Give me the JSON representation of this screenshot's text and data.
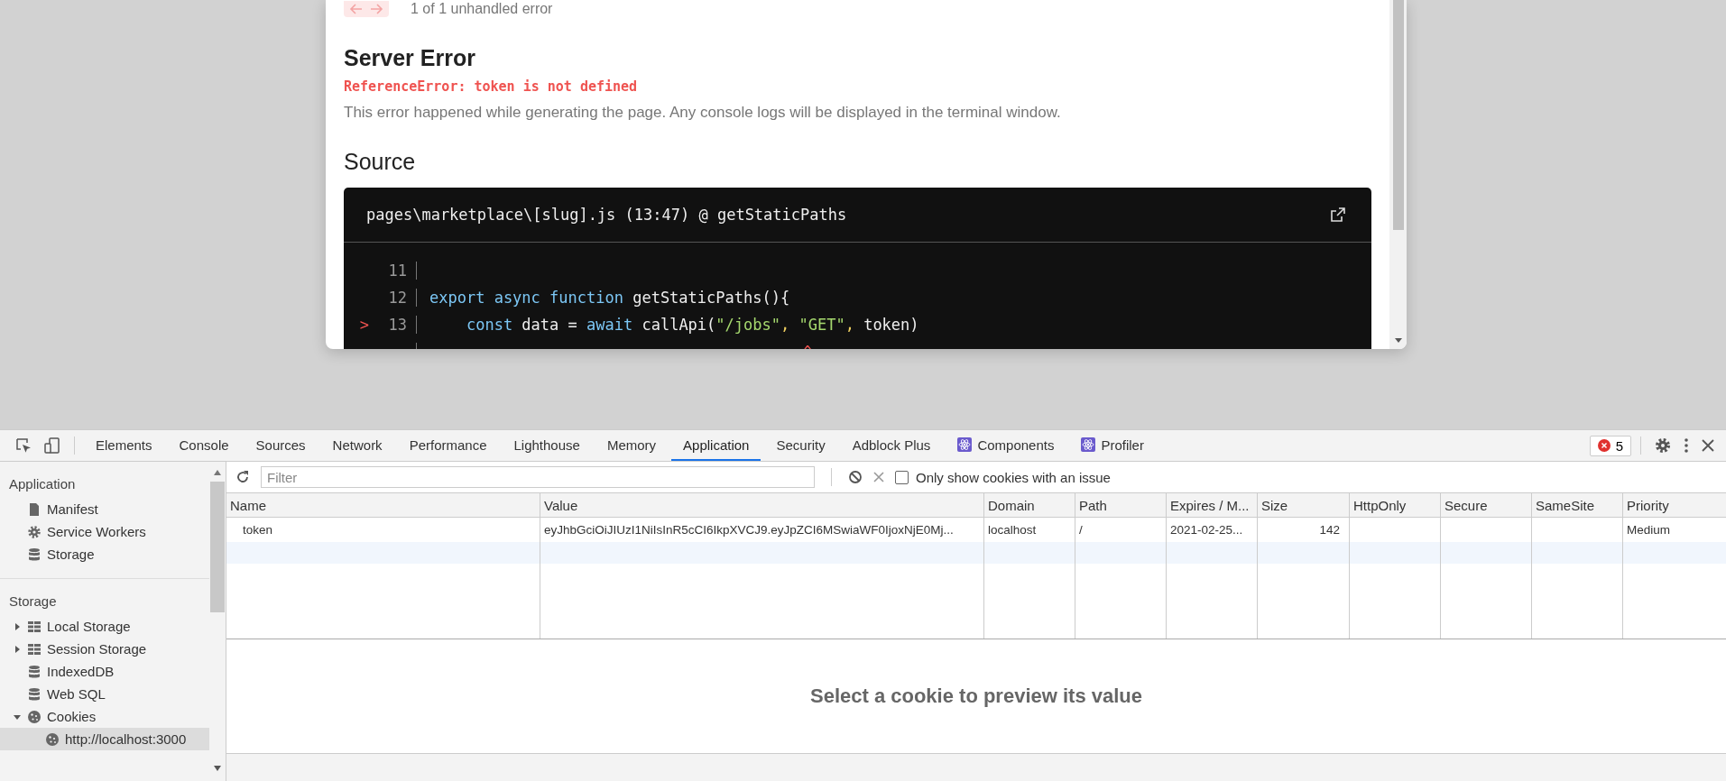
{
  "error_overlay": {
    "nav": {
      "counter": "1 of 1 unhandled error"
    },
    "title": "Server Error",
    "error_message": "ReferenceError: token is not defined",
    "description": "This error happened while generating the page. Any console logs will be displayed in the terminal window.",
    "source_heading": "Source",
    "source": {
      "file": "pages\\marketplace\\[slug].js (13:47) @ getStaticPaths",
      "lines": [
        {
          "number": "11"
        },
        {
          "number": "12",
          "tokens": [
            {
              "text": "export async function",
              "kind": "keyword"
            },
            {
              "text": " getStaticPaths(){",
              "kind": "plain"
            }
          ]
        },
        {
          "number": "13",
          "marker": ">",
          "tokens": [
            {
              "text": "    const",
              "kind": "keyword"
            },
            {
              "text": " data = ",
              "kind": "plain"
            },
            {
              "text": "await",
              "kind": "keyword"
            },
            {
              "text": " callApi(",
              "kind": "plain"
            },
            {
              "text": "\"/jobs\"",
              "kind": "string"
            },
            {
              "text": ",",
              "kind": "punct"
            },
            {
              "text": " \"GET\"",
              "kind": "string"
            },
            {
              "text": ",",
              "kind": "punct"
            },
            {
              "text": " token)",
              "kind": "plain"
            }
          ]
        },
        {
          "pointer": "^"
        }
      ]
    }
  },
  "devtools": {
    "tabs": [
      {
        "label": "Elements",
        "selected": false
      },
      {
        "label": "Console",
        "selected": false
      },
      {
        "label": "Sources",
        "selected": false
      },
      {
        "label": "Network",
        "selected": false
      },
      {
        "label": "Performance",
        "selected": false
      },
      {
        "label": "Lighthouse",
        "selected": false
      },
      {
        "label": "Memory",
        "selected": false
      },
      {
        "label": "Application",
        "selected": true
      },
      {
        "label": "Security",
        "selected": false
      },
      {
        "label": "Adblock Plus",
        "selected": false
      },
      {
        "label": "Components",
        "selected": false,
        "kind": "extension"
      },
      {
        "label": "Profiler",
        "selected": false,
        "kind": "extension"
      }
    ],
    "error_count": "5",
    "sidebar": {
      "sections": [
        {
          "title": "Application",
          "items": [
            {
              "label": "Manifest",
              "kind": "file",
              "selected": false
            },
            {
              "label": "Service Workers",
              "kind": "worker",
              "selected": false
            },
            {
              "label": "Storage",
              "kind": "database",
              "selected": false
            }
          ]
        },
        {
          "title": "Storage",
          "items": [
            {
              "label": "Local Storage",
              "kind": "keyvalue",
              "expanded": false,
              "selected": false
            },
            {
              "label": "Session Storage",
              "kind": "keyvalue",
              "expanded": false,
              "selected": false
            },
            {
              "label": "IndexedDB",
              "kind": "database",
              "selected": false
            },
            {
              "label": "Web SQL",
              "kind": "database",
              "selected": false
            },
            {
              "label": "Cookies",
              "kind": "cookie",
              "expanded": true,
              "selected": false,
              "children": [
                {
                  "label": "http://localhost:3000",
                  "kind": "cookie",
                  "selected": true
                }
              ]
            }
          ]
        }
      ]
    },
    "toolbar": {
      "filter_placeholder": "Filter",
      "only_issues": {
        "label": "Only show cookies with an issue",
        "checked": false
      }
    },
    "table": {
      "columns": [
        "Name",
        "Value",
        "Domain",
        "Path",
        "Expires / M...",
        "Size",
        "HttpOnly",
        "Secure",
        "SameSite",
        "Priority"
      ],
      "rows": [
        {
          "selected": false,
          "cells": [
            "token",
            "eyJhbGciOiJIUzI1NiIsInR5cCI6IkpXVCJ9.eyJpZCI6MSwiaWF0IjoxNjE0Mj...",
            "localhost",
            "/",
            "2021-02-25...",
            "142",
            null,
            null,
            null,
            "Medium"
          ]
        }
      ]
    },
    "preview_message": "Select a cookie to preview its value"
  }
}
